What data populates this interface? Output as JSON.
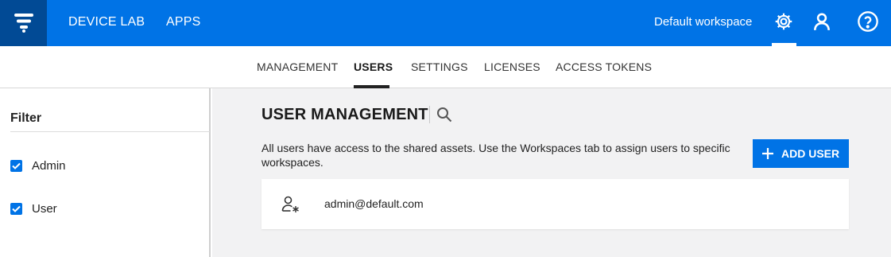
{
  "topbar": {
    "nav": [
      {
        "label": "DEVICE LAB"
      },
      {
        "label": "APPS"
      }
    ],
    "workspace": "Default workspace",
    "icons": [
      "logo-icon",
      "gear-icon",
      "user-icon",
      "help-icon"
    ],
    "bg_color": "#0073e6",
    "logo_bg_color": "#014a95"
  },
  "tabs": {
    "items": [
      {
        "label": "MANAGEMENT"
      },
      {
        "label": "USERS"
      },
      {
        "label": "SETTINGS"
      },
      {
        "label": "LICENSES"
      },
      {
        "label": "ACCESS TOKENS"
      }
    ],
    "active": "USERS"
  },
  "sidebar": {
    "title": "Filter",
    "filters": [
      {
        "label": "Admin",
        "checked": true
      },
      {
        "label": "User",
        "checked": true
      }
    ]
  },
  "main": {
    "title": "USER MANAGEMENT",
    "description": "All users have access to the shared assets. Use the Workspaces tab to assign users to specific workspaces.",
    "add_button": "ADD USER",
    "users": [
      {
        "email": "admin@default.com",
        "role_icon": "admin-user-icon"
      }
    ]
  }
}
